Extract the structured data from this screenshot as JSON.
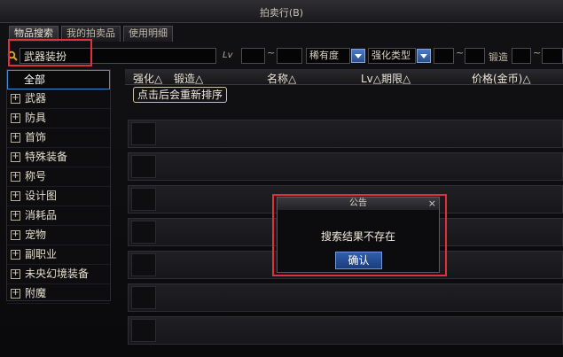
{
  "window": {
    "title": "拍卖行(B)"
  },
  "tabs": [
    {
      "label": "物品搜索"
    },
    {
      "label": "我的拍卖品"
    },
    {
      "label": "使用明细"
    }
  ],
  "search": {
    "value": "武器装扮",
    "icon": "search-icon",
    "lv_label": "Lv",
    "tilde": "~",
    "rarity_label": "稀有度",
    "enhance_type_label": "强化类型",
    "forge_label": "锻造"
  },
  "categories": [
    {
      "label": "全部"
    },
    {
      "label": "武器"
    },
    {
      "label": "防具"
    },
    {
      "label": "首饰"
    },
    {
      "label": "特殊装备"
    },
    {
      "label": "称号"
    },
    {
      "label": "设计图"
    },
    {
      "label": "消耗品"
    },
    {
      "label": "宠物"
    },
    {
      "label": "副职业"
    },
    {
      "label": "未央幻境装备"
    },
    {
      "label": "附魔"
    }
  ],
  "table": {
    "headers": {
      "enhance": "强化△",
      "forge": "锻造△",
      "name": "名称△",
      "lv_period": "Lv△期限△",
      "price": "价格(金币)△"
    },
    "tooltip": "点击后会重新排序"
  },
  "dialog": {
    "title": "公告",
    "close": "×",
    "message": "搜索结果不存在",
    "confirm": "确认"
  },
  "colors": {
    "highlight": "#e0303a",
    "accent_blue": "#2f5fb0"
  }
}
